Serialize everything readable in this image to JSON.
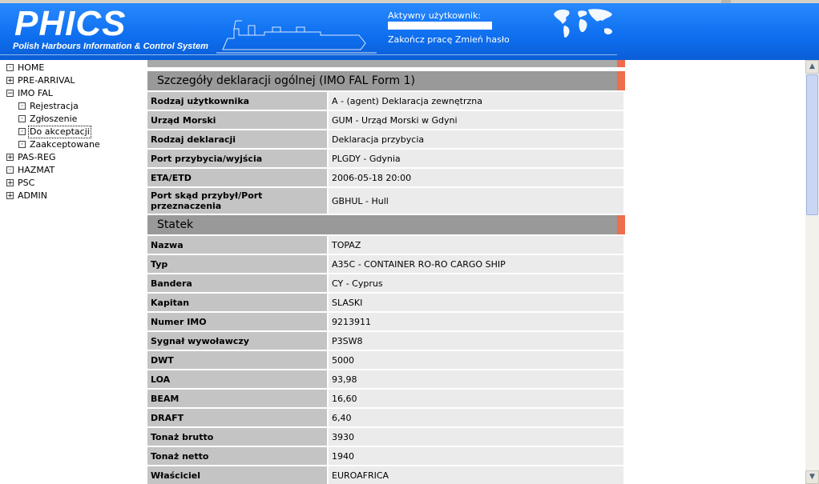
{
  "header": {
    "logo": "PHICS",
    "logo_subtitle": "Polish Harbours Information & Control System",
    "active_user_label": "Aktywny użytkownik:",
    "logout_link": "Zakończ pracę",
    "change_password_link": "Zmień hasło"
  },
  "nav": {
    "items": [
      {
        "label": "HOME",
        "box": "·"
      },
      {
        "label": "PRE-ARRIVAL",
        "box": "+"
      },
      {
        "label": "IMO FAL",
        "box": "−"
      },
      {
        "label": "Rejestracja",
        "box": "·"
      },
      {
        "label": "Zgłoszenie",
        "box": "·"
      },
      {
        "label": "Do akceptacji",
        "box": "·"
      },
      {
        "label": "Zaakceptowane",
        "box": "·"
      },
      {
        "label": "PAS-REG",
        "box": "+"
      },
      {
        "label": "HAZMAT",
        "box": "·"
      },
      {
        "label": "PSC",
        "box": "+"
      },
      {
        "label": "ADMIN",
        "box": "+"
      }
    ]
  },
  "main": {
    "general_title": "Szczegóły deklaracji ogólnej (IMO FAL Form 1)",
    "general_rows": [
      {
        "label": "Rodzaj użytkownika",
        "value": "A - (agent) Deklaracja zewnętrzna"
      },
      {
        "label": "Urząd Morski",
        "value": "GUM - Urząd Morski w Gdyni"
      },
      {
        "label": "Rodzaj deklaracji",
        "value": "Deklaracja przybycia"
      },
      {
        "label": "Port przybycia/wyjścia",
        "value": "PLGDY - Gdynia"
      },
      {
        "label": "ETA/ETD",
        "value": "2006-05-18 20:00"
      },
      {
        "label": "Port skąd przybył/Port przeznaczenia",
        "value": "GBHUL - Hull"
      }
    ],
    "ship_title": "Statek",
    "ship_rows": [
      {
        "label": "Nazwa",
        "value": "TOPAZ"
      },
      {
        "label": "Typ",
        "value": "A35C - CONTAINER RO-RO CARGO SHIP"
      },
      {
        "label": "Bandera",
        "value": "CY - Cyprus"
      },
      {
        "label": "Kapitan",
        "value": "SLASKI"
      },
      {
        "label": "Numer IMO",
        "value": "9213911"
      },
      {
        "label": "Sygnał wywoławczy",
        "value": "P3SW8"
      },
      {
        "label": "DWT",
        "value": "5000"
      },
      {
        "label": "LOA",
        "value": "93,98"
      },
      {
        "label": "BEAM",
        "value": "16,60"
      },
      {
        "label": "DRAFT",
        "value": "6,40"
      },
      {
        "label": "Tonaż brutto",
        "value": "3930"
      },
      {
        "label": "Tonaż netto",
        "value": "1940"
      },
      {
        "label": "Właściciel",
        "value": "EUROAFRICA"
      }
    ]
  },
  "colors": {
    "header_blue": "#0e6ff0",
    "section_gray": "#999999",
    "accent_orange": "#ef6d4c"
  }
}
